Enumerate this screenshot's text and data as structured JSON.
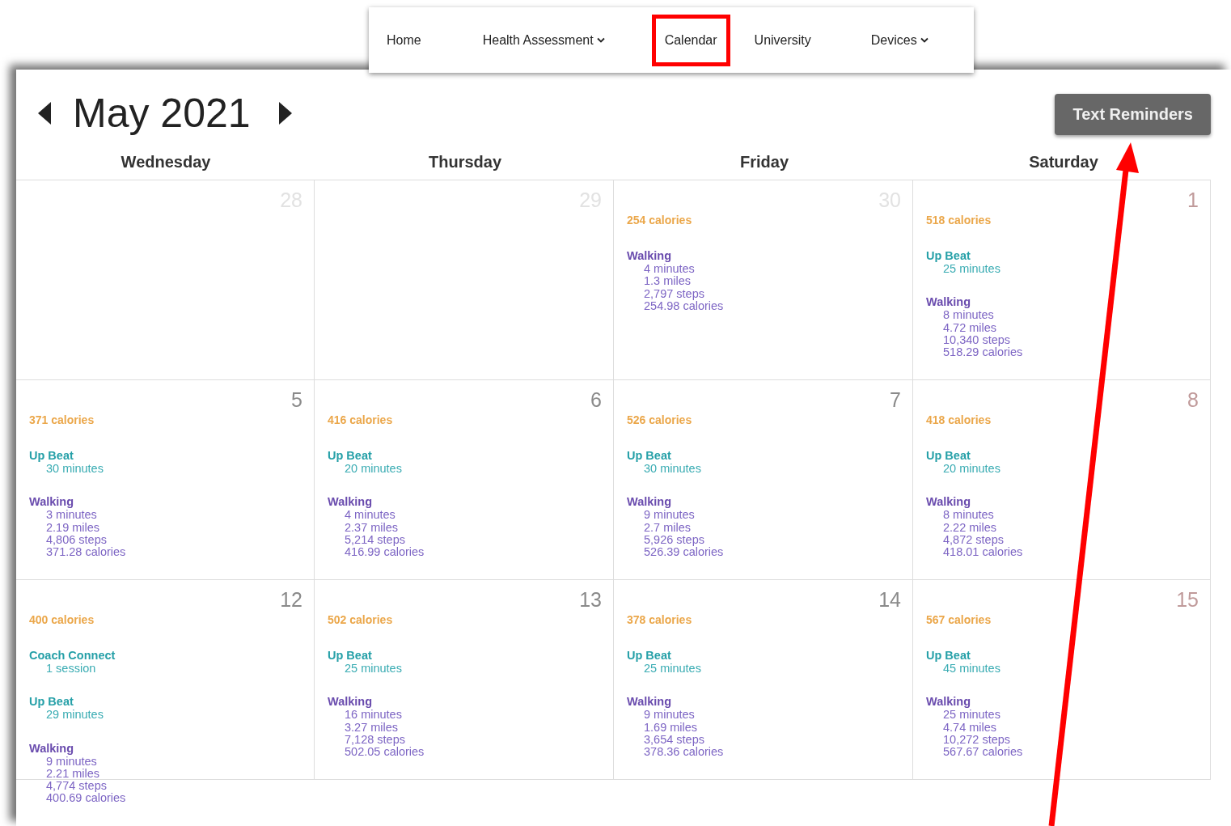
{
  "nav": [
    {
      "label": "Home",
      "dropdown": false,
      "highlighted": false
    },
    {
      "label": "Health Assessment",
      "dropdown": true,
      "highlighted": false
    },
    {
      "label": "Calendar",
      "dropdown": false,
      "highlighted": true
    },
    {
      "label": "University",
      "dropdown": false,
      "highlighted": false
    },
    {
      "label": "Devices",
      "dropdown": true,
      "highlighted": false
    }
  ],
  "calendar": {
    "title": "May 2021",
    "reminder_button": "Text Reminders",
    "weekdays": [
      "Wednesday",
      "Thursday",
      "Friday",
      "Saturday"
    ],
    "weeks": [
      [
        {
          "number": "28",
          "kind": "outside"
        },
        {
          "number": "29",
          "kind": "outside"
        },
        {
          "number": "30",
          "kind": "outside",
          "total": "254 calories",
          "activities": [
            {
              "name": "Walking",
              "kind": "walking",
              "details": [
                "4 minutes",
                "1.3 miles",
                "2,797 steps",
                "254.98 calories"
              ]
            }
          ]
        },
        {
          "number": "1",
          "kind": "weekend",
          "total": "518 calories",
          "activities": [
            {
              "name": "Up Beat",
              "kind": "program",
              "details": [
                "25 minutes"
              ]
            },
            {
              "name": "Walking",
              "kind": "walking",
              "details": [
                "8 minutes",
                "4.72 miles",
                "10,340 steps",
                "518.29 calories"
              ]
            }
          ]
        }
      ],
      [
        {
          "number": "5",
          "kind": "weekday",
          "total": "371 calories",
          "activities": [
            {
              "name": "Up Beat",
              "kind": "program",
              "details": [
                "30 minutes"
              ]
            },
            {
              "name": "Walking",
              "kind": "walking",
              "details": [
                "3 minutes",
                "2.19 miles",
                "4,806 steps",
                "371.28 calories"
              ]
            }
          ]
        },
        {
          "number": "6",
          "kind": "weekday",
          "total": "416 calories",
          "activities": [
            {
              "name": "Up Beat",
              "kind": "program",
              "details": [
                "20 minutes"
              ]
            },
            {
              "name": "Walking",
              "kind": "walking",
              "details": [
                "4 minutes",
                "2.37 miles",
                "5,214 steps",
                "416.99 calories"
              ]
            }
          ]
        },
        {
          "number": "7",
          "kind": "weekday",
          "total": "526 calories",
          "activities": [
            {
              "name": "Up Beat",
              "kind": "program",
              "details": [
                "30 minutes"
              ]
            },
            {
              "name": "Walking",
              "kind": "walking",
              "details": [
                "9 minutes",
                "2.7 miles",
                "5,926 steps",
                "526.39 calories"
              ]
            }
          ]
        },
        {
          "number": "8",
          "kind": "weekend",
          "total": "418 calories",
          "activities": [
            {
              "name": "Up Beat",
              "kind": "program",
              "details": [
                "20 minutes"
              ]
            },
            {
              "name": "Walking",
              "kind": "walking",
              "details": [
                "8 minutes",
                "2.22 miles",
                "4,872 steps",
                "418.01 calories"
              ]
            }
          ]
        }
      ],
      [
        {
          "number": "12",
          "kind": "weekday",
          "total": "400 calories",
          "activities": [
            {
              "name": "Coach Connect",
              "kind": "program",
              "details": [
                "1 session"
              ]
            },
            {
              "name": "Up Beat",
              "kind": "program",
              "details": [
                "29 minutes"
              ]
            },
            {
              "name": "Walking",
              "kind": "walking",
              "details": [
                "9 minutes",
                "2.21 miles",
                "4,774 steps",
                "400.69 calories"
              ]
            }
          ]
        },
        {
          "number": "13",
          "kind": "weekday",
          "total": "502 calories",
          "activities": [
            {
              "name": "Up Beat",
              "kind": "program",
              "details": [
                "25 minutes"
              ]
            },
            {
              "name": "Walking",
              "kind": "walking",
              "details": [
                "16 minutes",
                "3.27 miles",
                "7,128 steps",
                "502.05 calories"
              ]
            }
          ]
        },
        {
          "number": "14",
          "kind": "weekday",
          "total": "378 calories",
          "activities": [
            {
              "name": "Up Beat",
              "kind": "program",
              "details": [
                "25 minutes"
              ]
            },
            {
              "name": "Walking",
              "kind": "walking",
              "details": [
                "9 minutes",
                "1.69 miles",
                "3,654 steps",
                "378.36 calories"
              ]
            }
          ]
        },
        {
          "number": "15",
          "kind": "weekend",
          "total": "567 calories",
          "activities": [
            {
              "name": "Up Beat",
              "kind": "program",
              "details": [
                "45 minutes"
              ]
            },
            {
              "name": "Walking",
              "kind": "walking",
              "details": [
                "25 minutes",
                "4.74 miles",
                "10,272 steps",
                "567.67 calories"
              ]
            }
          ]
        }
      ]
    ]
  }
}
